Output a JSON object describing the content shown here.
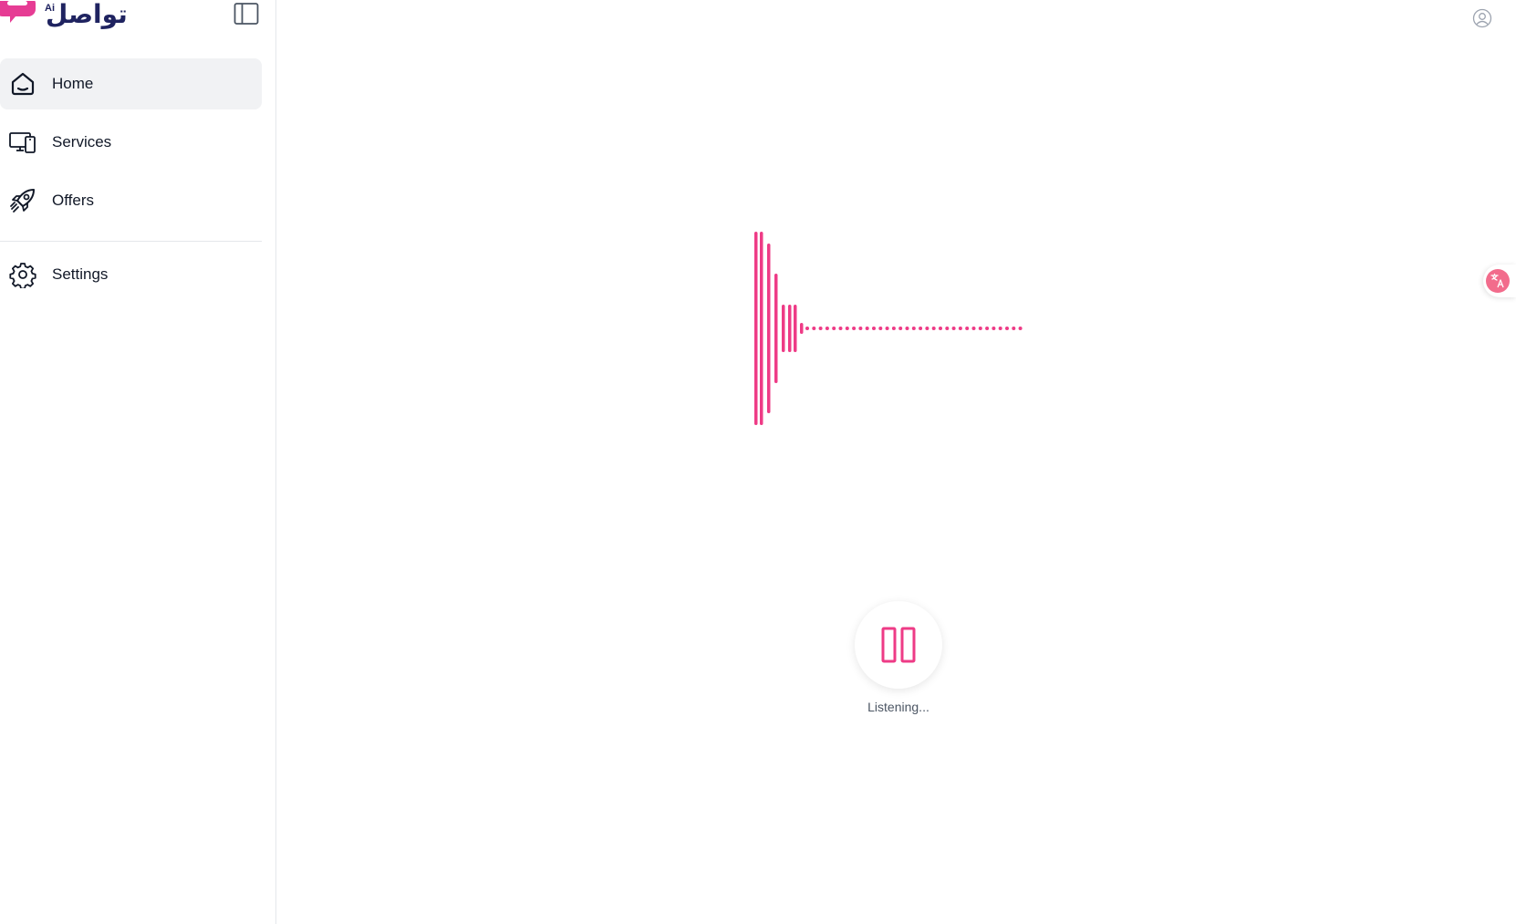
{
  "logo": {
    "arabic_text": "تواصل",
    "ai_badge": "Ai"
  },
  "sidebar": {
    "items": [
      {
        "label": "Home",
        "icon": "home-icon",
        "active": true
      },
      {
        "label": "Services",
        "icon": "devices-icon",
        "active": false
      },
      {
        "label": "Offers",
        "icon": "rocket-icon",
        "active": false
      }
    ],
    "settings": {
      "label": "Settings",
      "icon": "gear-icon"
    }
  },
  "main": {
    "status": "Listening...",
    "pause_icon": "pause-icon",
    "waveform_icon": "audio-waveform"
  },
  "colors": {
    "accent": "#ee3b86",
    "logo_navy": "#1f2360",
    "active_bg": "#f1f2f4",
    "divider": "#e5e7eb"
  }
}
